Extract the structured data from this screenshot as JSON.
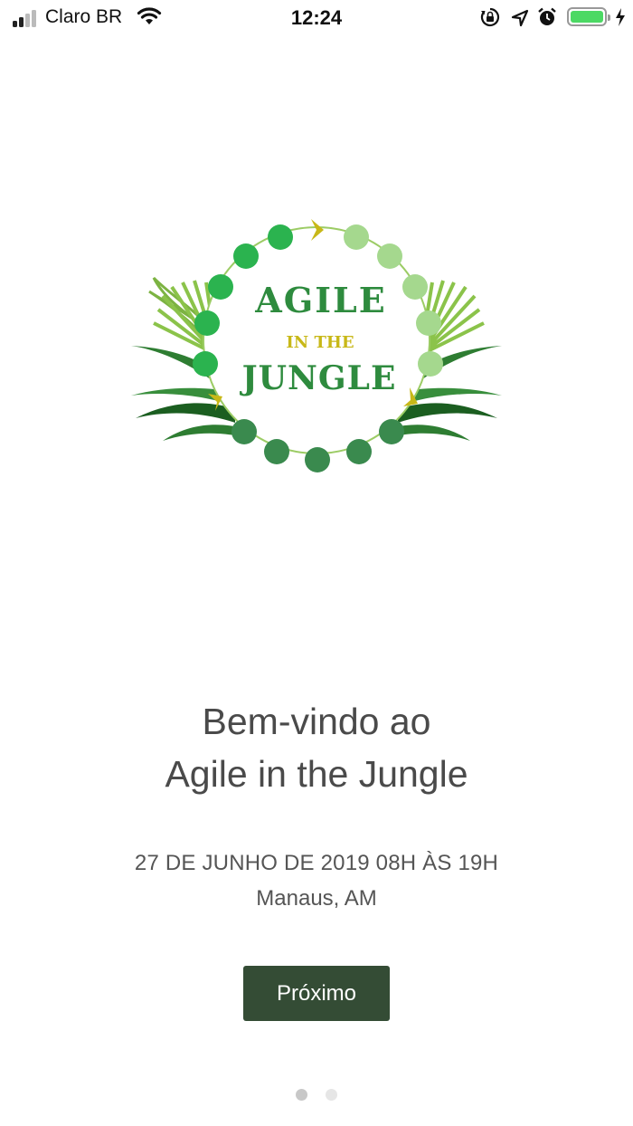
{
  "status_bar": {
    "carrier": "Claro BR",
    "time": "12:24",
    "signal_bars_filled": 2,
    "signal_bars_total": 4,
    "icons": [
      "wifi-icon",
      "orientation-lock-icon",
      "location-arrow-icon",
      "alarm-clock-icon",
      "battery-icon",
      "charging-bolt-icon"
    ],
    "battery_level": 1.0,
    "battery_color": "#4cd964"
  },
  "logo": {
    "line1": "AGILE",
    "line2": "IN THE",
    "line3": "JUNGLE",
    "text_color": "#2e8b3e",
    "accent_color": "#c8b818"
  },
  "welcome": {
    "line1": "Bem-vindo ao",
    "line2": "Agile in the Jungle"
  },
  "event": {
    "date_time": "27 DE JUNHO DE 2019 08H ÀS 19H",
    "location": "Manaus, AM"
  },
  "next_button": {
    "label": "Próximo",
    "color": "#344c35"
  },
  "pager": {
    "current_page": 1,
    "total_pages": 2
  }
}
